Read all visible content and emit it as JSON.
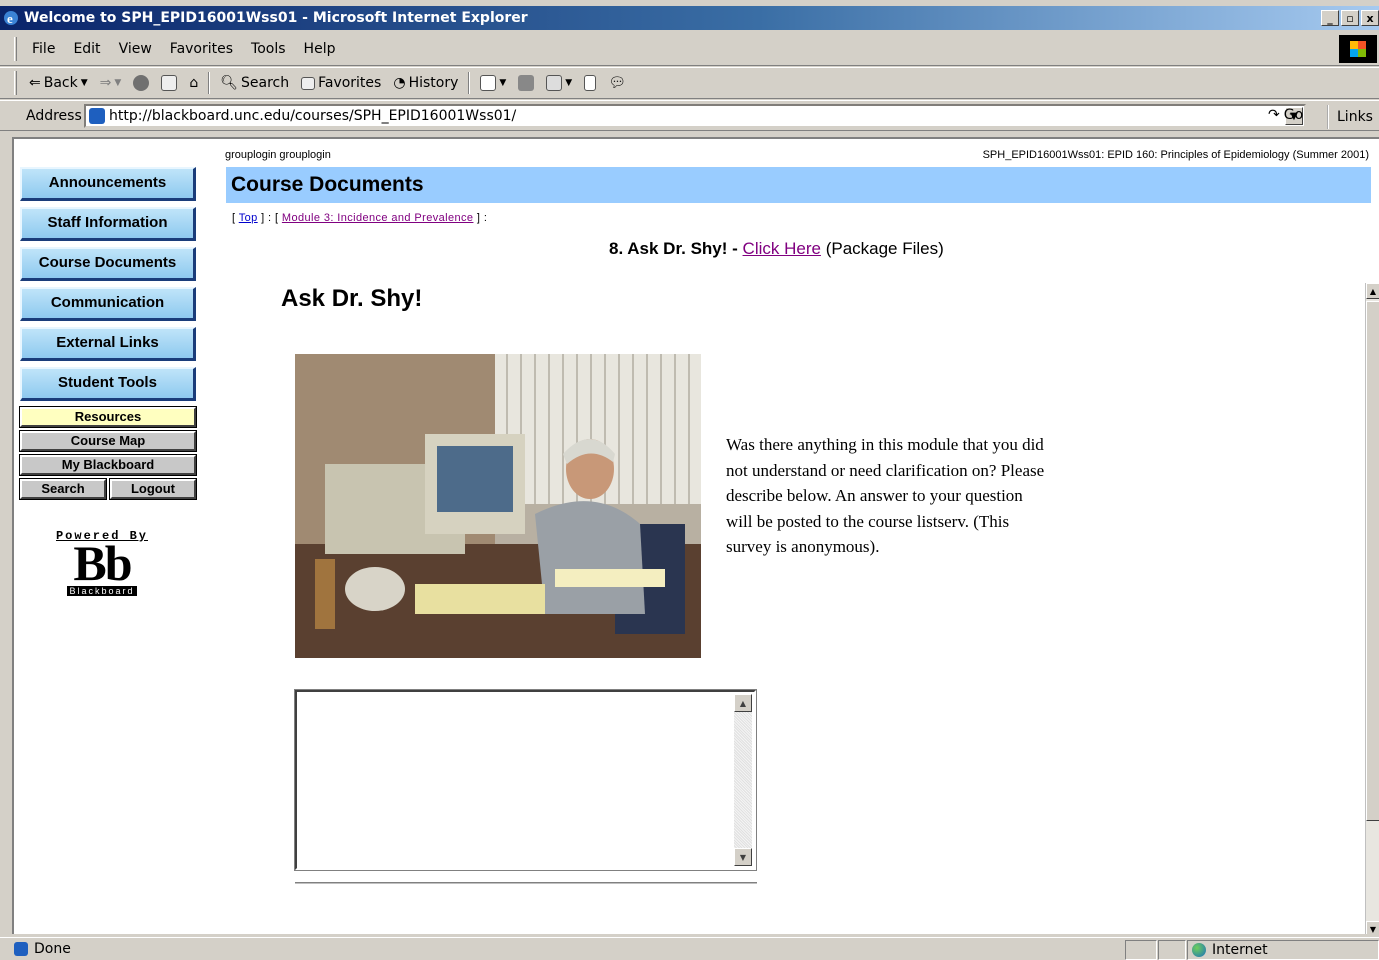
{
  "window": {
    "title": "Welcome to SPH_EPID16001Wss01 - Microsoft Internet Explorer",
    "controls": [
      "_",
      "3",
      "X"
    ]
  },
  "menu": [
    "File",
    "Edit",
    "View",
    "Favorites",
    "Tools",
    "Help"
  ],
  "toolbar": {
    "back": "Back",
    "search": "Search",
    "favorites": "Favorites",
    "history": "History"
  },
  "address": {
    "label": "Address",
    "url": "http://blackboard.unc.edu/courses/SPH_EPID16001Wss01/",
    "go": "Go",
    "links": "Links"
  },
  "nav": {
    "buttons": [
      "Announcements",
      "Staff Information",
      "Course Documents",
      "Communication",
      "External Links",
      "Student Tools"
    ],
    "resources": "Resources",
    "course_map": "Course Map",
    "my_blackboard": "My Blackboard",
    "search": "Search",
    "logout": "Logout",
    "powered_by": "Powered By",
    "bb_logo": "Bb",
    "bb_name": "Blackboard"
  },
  "page": {
    "user": "grouplogin grouplogin",
    "course": "SPH_EPID16001Wss01: EPID 160: Principles of Epidemiology (Summer 2001)",
    "section": "Course Documents",
    "crumb_open": "[",
    "crumb_top": "Top",
    "crumb_mid": "] : [",
    "crumb_module": "Module 3: Incidence and Prevalence",
    "crumb_close": "] :",
    "item_title": "8. Ask Dr. Shy! -",
    "click_here": "Click Here",
    "package_files": "(Package Files)",
    "heading": "Ask Dr. Shy!",
    "description": "Was there anything in this module that you did not understand or need clarification on? Please describe below. An answer to your question will be posted to the course listserv. (This survey is anonymous).",
    "textarea_value": ""
  },
  "status": {
    "text": "Done",
    "zone": "Internet"
  }
}
